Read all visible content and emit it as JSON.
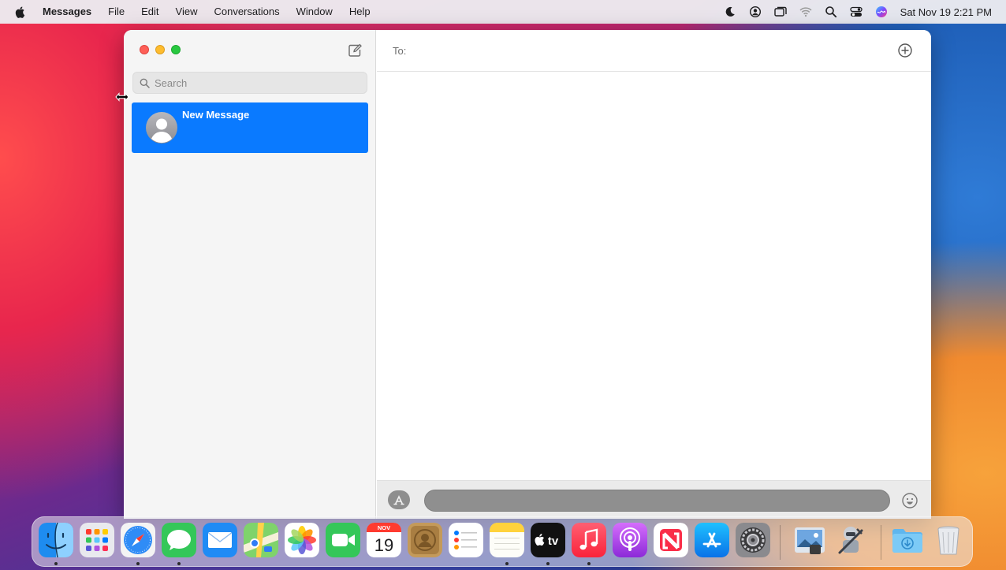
{
  "menubar": {
    "app_name": "Messages",
    "items": [
      "File",
      "Edit",
      "View",
      "Conversations",
      "Window",
      "Help"
    ],
    "clock": "Sat Nov 19  2:21 PM",
    "status_icons": [
      "moon-icon",
      "user-circle-icon",
      "screen-mirroring-icon",
      "wifi-icon",
      "spotlight-search-icon",
      "control-center-icon",
      "siri-icon"
    ]
  },
  "sidebar": {
    "search_placeholder": "Search",
    "conversations": [
      {
        "title": "New Message",
        "selected": true
      }
    ]
  },
  "main": {
    "to_label": "To:"
  },
  "dock": {
    "calendar_month": "NOV",
    "calendar_day": "19",
    "tv_label": "tv",
    "apps": [
      "Finder",
      "Launchpad",
      "Safari",
      "Messages",
      "Mail",
      "Maps",
      "Photos",
      "FaceTime",
      "Calendar",
      "Contacts",
      "Reminders",
      "Notes",
      "TV",
      "Music",
      "Podcasts",
      "News",
      "App Store",
      "System Preferences",
      "Preview",
      "Automator",
      "Downloads",
      "Trash"
    ]
  },
  "colors": {
    "selection": "#0a7aff",
    "close": "#fe5f57",
    "minimize": "#febc2e",
    "maximize": "#28c840"
  }
}
